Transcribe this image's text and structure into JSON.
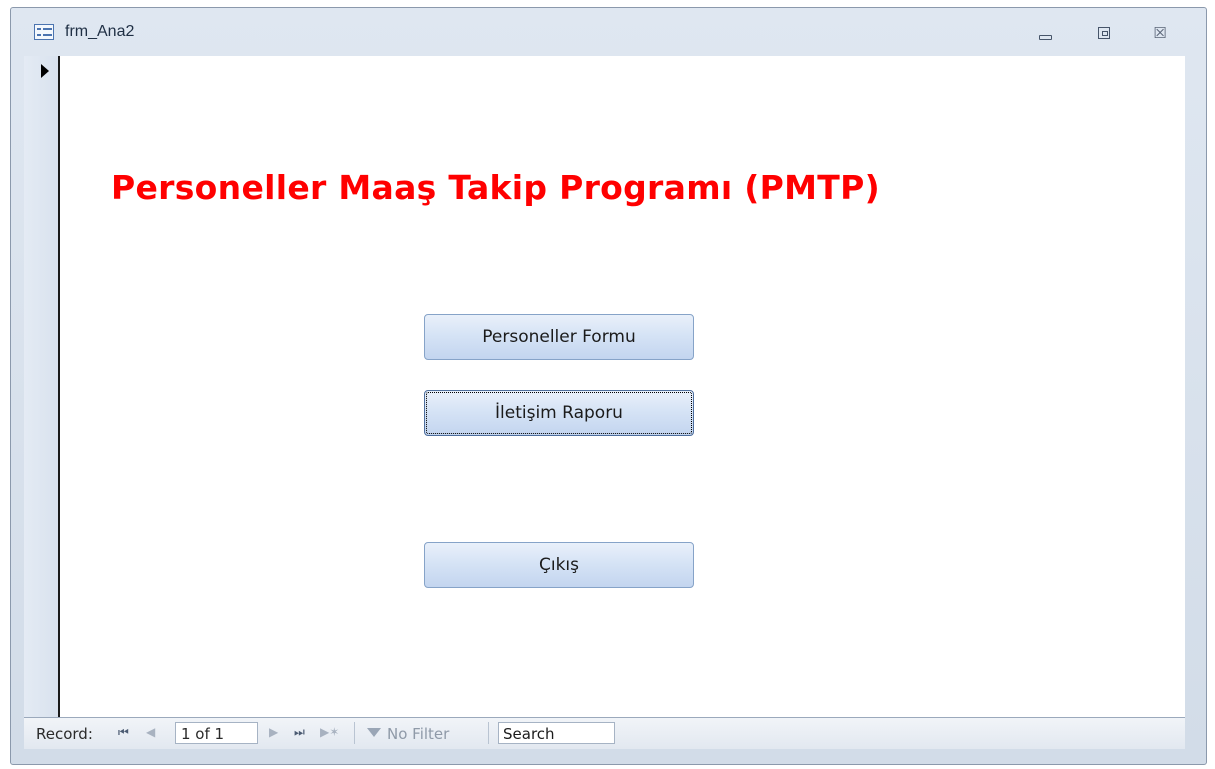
{
  "window": {
    "title": "frm_Ana2",
    "icon": "form-icon",
    "controls": {
      "minimize_icon": "minimize-icon",
      "restore_icon": "restore-icon",
      "close_symbol": "☒"
    }
  },
  "form": {
    "heading": "Personeller Maaş Takip Programı (PMTP)",
    "heading_color": "#ff0000",
    "buttons": [
      {
        "label": "Personeller Formu"
      },
      {
        "label": "İletişim Raporu",
        "focused": true
      },
      {
        "label": "Çıkış"
      }
    ]
  },
  "navigation": {
    "record_label": "Record:",
    "current": "1 of 1",
    "first_icon": "first-record-icon",
    "prev_icon": "previous-record-icon",
    "next_icon": "next-record-icon",
    "last_icon": "last-record-icon",
    "new_icon": "new-record-icon",
    "filter_label": "No Filter",
    "search_placeholder": "Search"
  }
}
